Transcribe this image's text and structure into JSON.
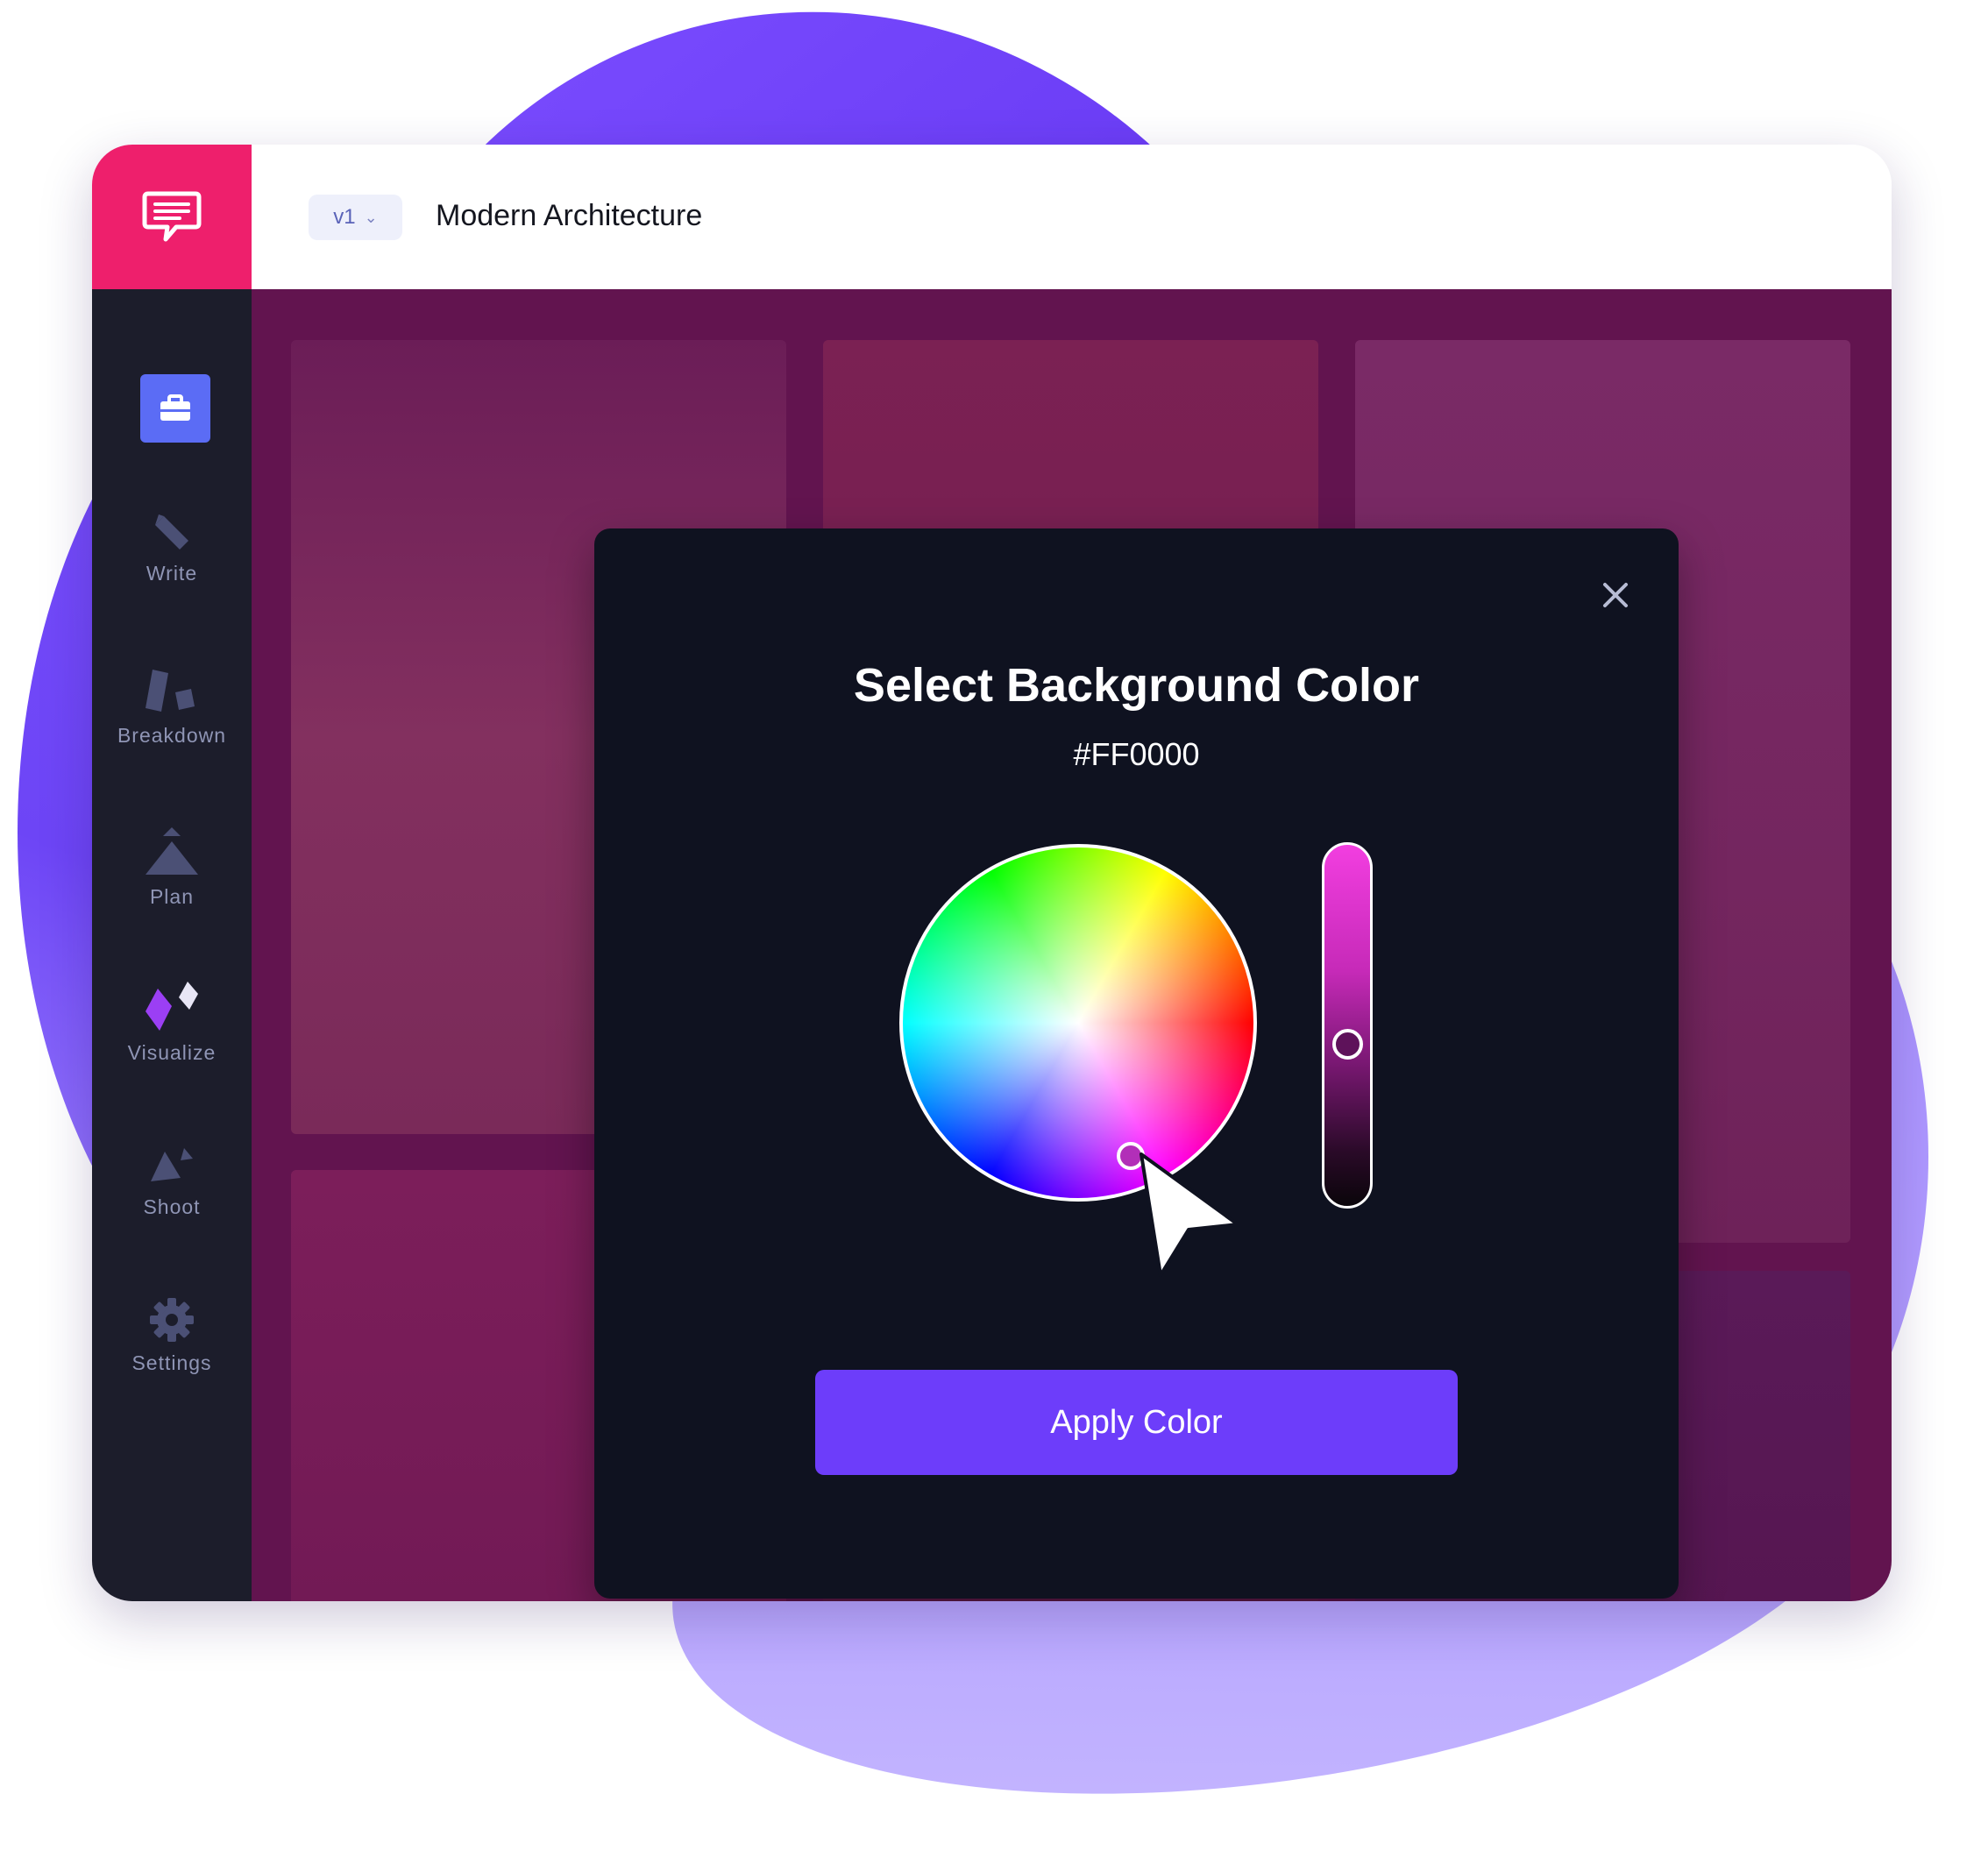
{
  "header": {
    "version_label": "v1",
    "document_title": "Modern Architecture"
  },
  "sidebar": {
    "items": [
      {
        "label": "",
        "icon": "briefcase-icon",
        "active": true
      },
      {
        "label": "Write",
        "icon": "pencil-icon"
      },
      {
        "label": "Breakdown",
        "icon": "breakdown-icon"
      },
      {
        "label": "Plan",
        "icon": "plan-icon"
      },
      {
        "label": "Visualize",
        "icon": "visualize-icon"
      },
      {
        "label": "Shoot",
        "icon": "shoot-icon"
      },
      {
        "label": "Settings",
        "icon": "gear-icon"
      }
    ]
  },
  "modal": {
    "title": "Select Background Color",
    "hex_value": "#FF0000",
    "apply_label": "Apply Color",
    "brightness_level": 0.55
  },
  "colors": {
    "brand_pink": "#ee1f6c",
    "sidebar_bg": "#1c1d2b",
    "active_item": "#5b6cf5",
    "canvas_overlay": "#62144f",
    "modal_bg": "#0f1220",
    "apply_button": "#6d3dfa",
    "blob_purple": "#7b4dff"
  }
}
